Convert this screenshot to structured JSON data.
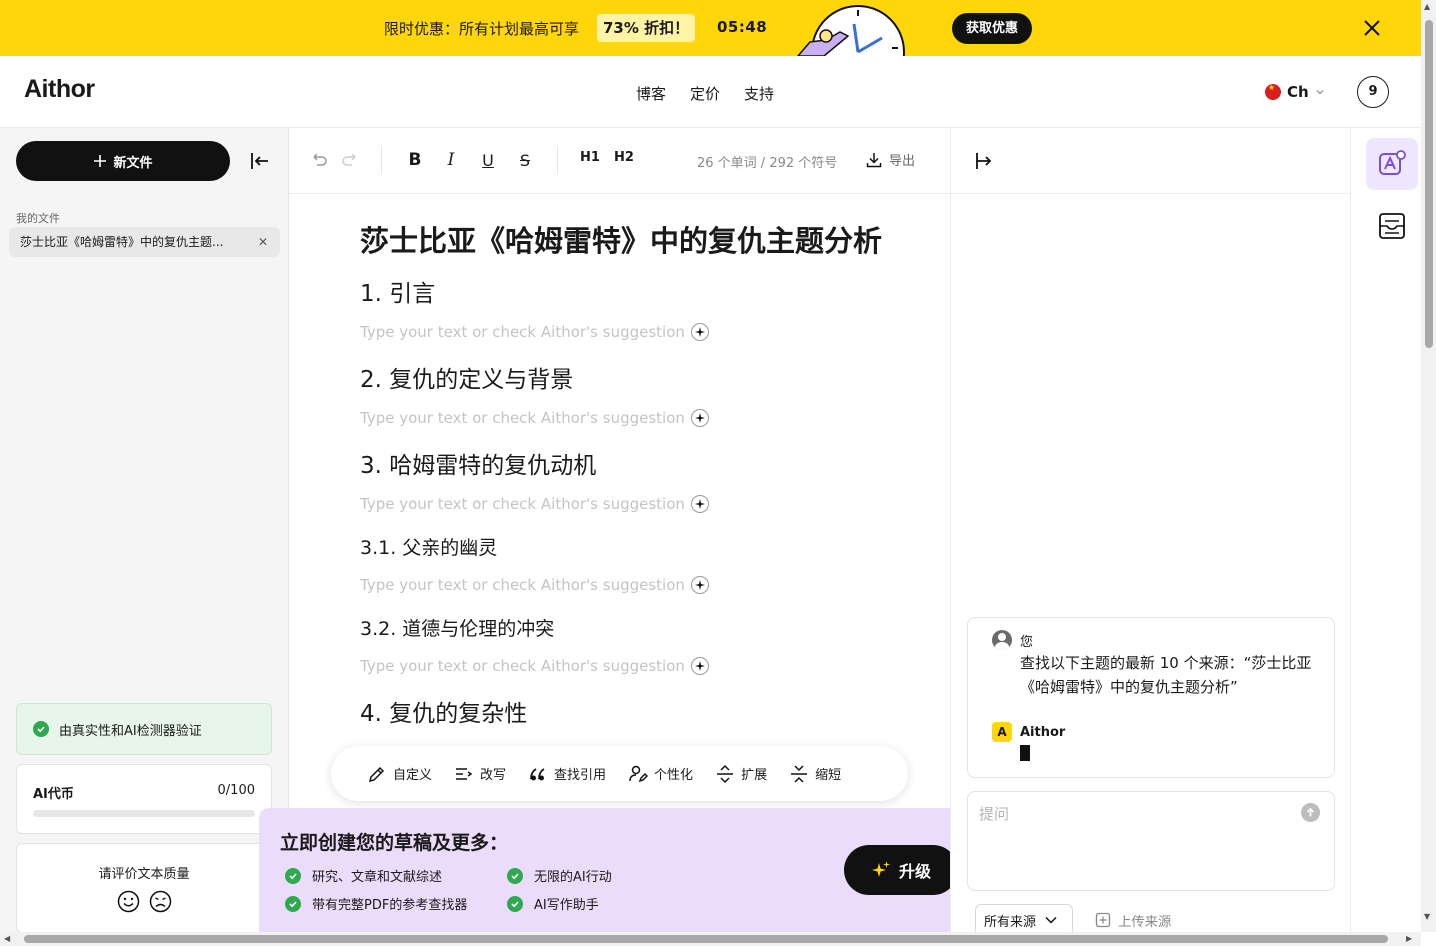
{
  "promo": {
    "text": "限时优惠：所有计划最高可享",
    "discount": "73% 折扣！",
    "timer": "05:48",
    "cta": "获取优惠"
  },
  "header": {
    "logo": "Aithor",
    "nav": [
      "博客",
      "定价",
      "支持"
    ],
    "language": "Ch",
    "avatar_count": "9"
  },
  "sidebar": {
    "new_file": "新文件",
    "my_files_label": "我的文件",
    "files": [
      "莎士比亚《哈姆雷特》中的复仇主题..."
    ],
    "verified": "由真实性和AI检测器验证",
    "credits_label": "AI代币",
    "credits_value": "0/100",
    "credits_fraction": 0,
    "rate_label": "请评价文本质量"
  },
  "toolbar": {
    "h1": "H1",
    "h2": "H2",
    "count": "26 个单词 / 292 个符号",
    "export": "导出"
  },
  "document": {
    "title": "莎士比亚《哈姆雷特》中的复仇主题分析",
    "placeholder": "Type your text or check Aithor's suggestion",
    "sections": [
      {
        "level": "h2",
        "text": "1. 引言"
      },
      {
        "level": "h2",
        "text": "2. 复仇的定义与背景"
      },
      {
        "level": "h2",
        "text": "3. 哈姆雷特的复仇动机"
      },
      {
        "level": "h3",
        "text": "3.1. 父亲的幽灵"
      },
      {
        "level": "h3",
        "text": "3.2. 道德与伦理的冲突"
      },
      {
        "level": "h2",
        "text": "4. 复仇的复杂性"
      }
    ]
  },
  "floatbar": {
    "items": [
      "自定义",
      "改写",
      "查找引用",
      "个性化",
      "扩展",
      "缩短"
    ]
  },
  "upsell": {
    "title": "立即创建您的草稿及更多：",
    "features": [
      "研究、文章和文献综述",
      "无限的AI行动",
      "带有完整PDF的参考查找器",
      "AI写作助手"
    ],
    "button": "升级"
  },
  "chat": {
    "you_label": "您",
    "you_message": "查找以下主题的最新 10 个来源：“莎士比亚《哈姆雷特》中的复仇主题分析”",
    "assistant_label": "Aithor",
    "assistant_badge": "A",
    "ask_placeholder": "提问",
    "sources_select": "所有来源",
    "upload": "上传来源"
  },
  "colors": {
    "promo_bg": "#ffd60a",
    "primary_dark": "#111111",
    "upsell_bg": "#ecdcfb",
    "check_green": "#2fa84f",
    "rail_active": "#efe6ff"
  }
}
